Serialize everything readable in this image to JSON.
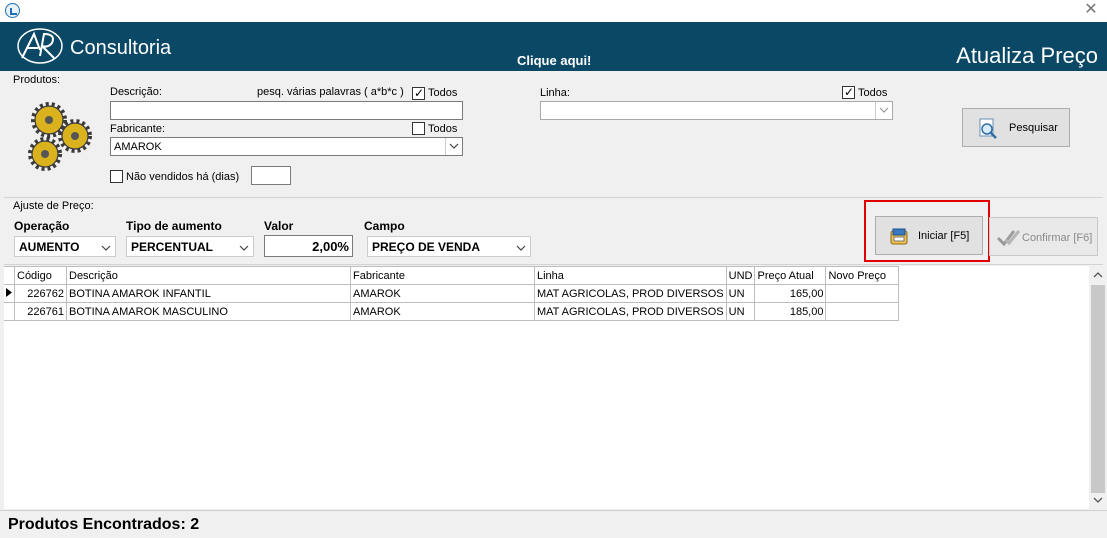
{
  "window": {
    "close_symbol": "✕"
  },
  "header": {
    "logo_text": "Consultoria",
    "link_text": "Clique aqui!",
    "title": "Atualiza Preço",
    "bg_color": "#0b4865"
  },
  "produtos": {
    "group_label": "Produtos:",
    "descricao_label": "Descrição:",
    "multi_word_hint": "pesq. várias palavras ( a*b*c )",
    "descricao_todos_label": "Todos",
    "descricao_todos_checked": true,
    "descricao_value": "",
    "fabricante_label": "Fabricante:",
    "fabricante_todos_label": "Todos",
    "fabricante_todos_checked": false,
    "fabricante_value": "AMAROK",
    "linha_label": "Linha:",
    "linha_todos_label": "Todos",
    "linha_todos_checked": true,
    "linha_value": "",
    "nao_vendidos_label": "Não vendidos há (dias)",
    "nao_vendidos_checked": false,
    "nao_vendidos_value": "",
    "pesquisar_label": "Pesquisar"
  },
  "ajuste": {
    "group_label": "Ajuste de Preço:",
    "operacao_label": "Operação",
    "operacao_value": "AUMENTO",
    "tipo_label": "Tipo de aumento",
    "tipo_value": "PERCENTUAL",
    "valor_label": "Valor",
    "valor_value": "2,00%",
    "campo_label": "Campo",
    "campo_value": "PREÇO DE VENDA",
    "iniciar_label": "Iniciar [F5]",
    "confirmar_label": "Confirmar [F6]",
    "highlight_color": "#e00000"
  },
  "grid": {
    "columns": [
      "Código",
      "Descrição",
      "Fabricante",
      "Linha",
      "UND",
      "Preço Atual",
      "Novo Preço"
    ],
    "rows": [
      [
        "226762",
        "BOTINA AMAROK INFANTIL",
        "AMAROK",
        "MAT AGRICOLAS, PROD DIVERSOS",
        "UN",
        "165,00",
        ""
      ],
      [
        "226761",
        "BOTINA AMAROK MASCULINO",
        "AMAROK",
        "MAT AGRICOLAS, PROD DIVERSOS",
        "UN",
        "185,00",
        ""
      ]
    ]
  },
  "status": {
    "text": "Produtos Encontrados: 2"
  }
}
